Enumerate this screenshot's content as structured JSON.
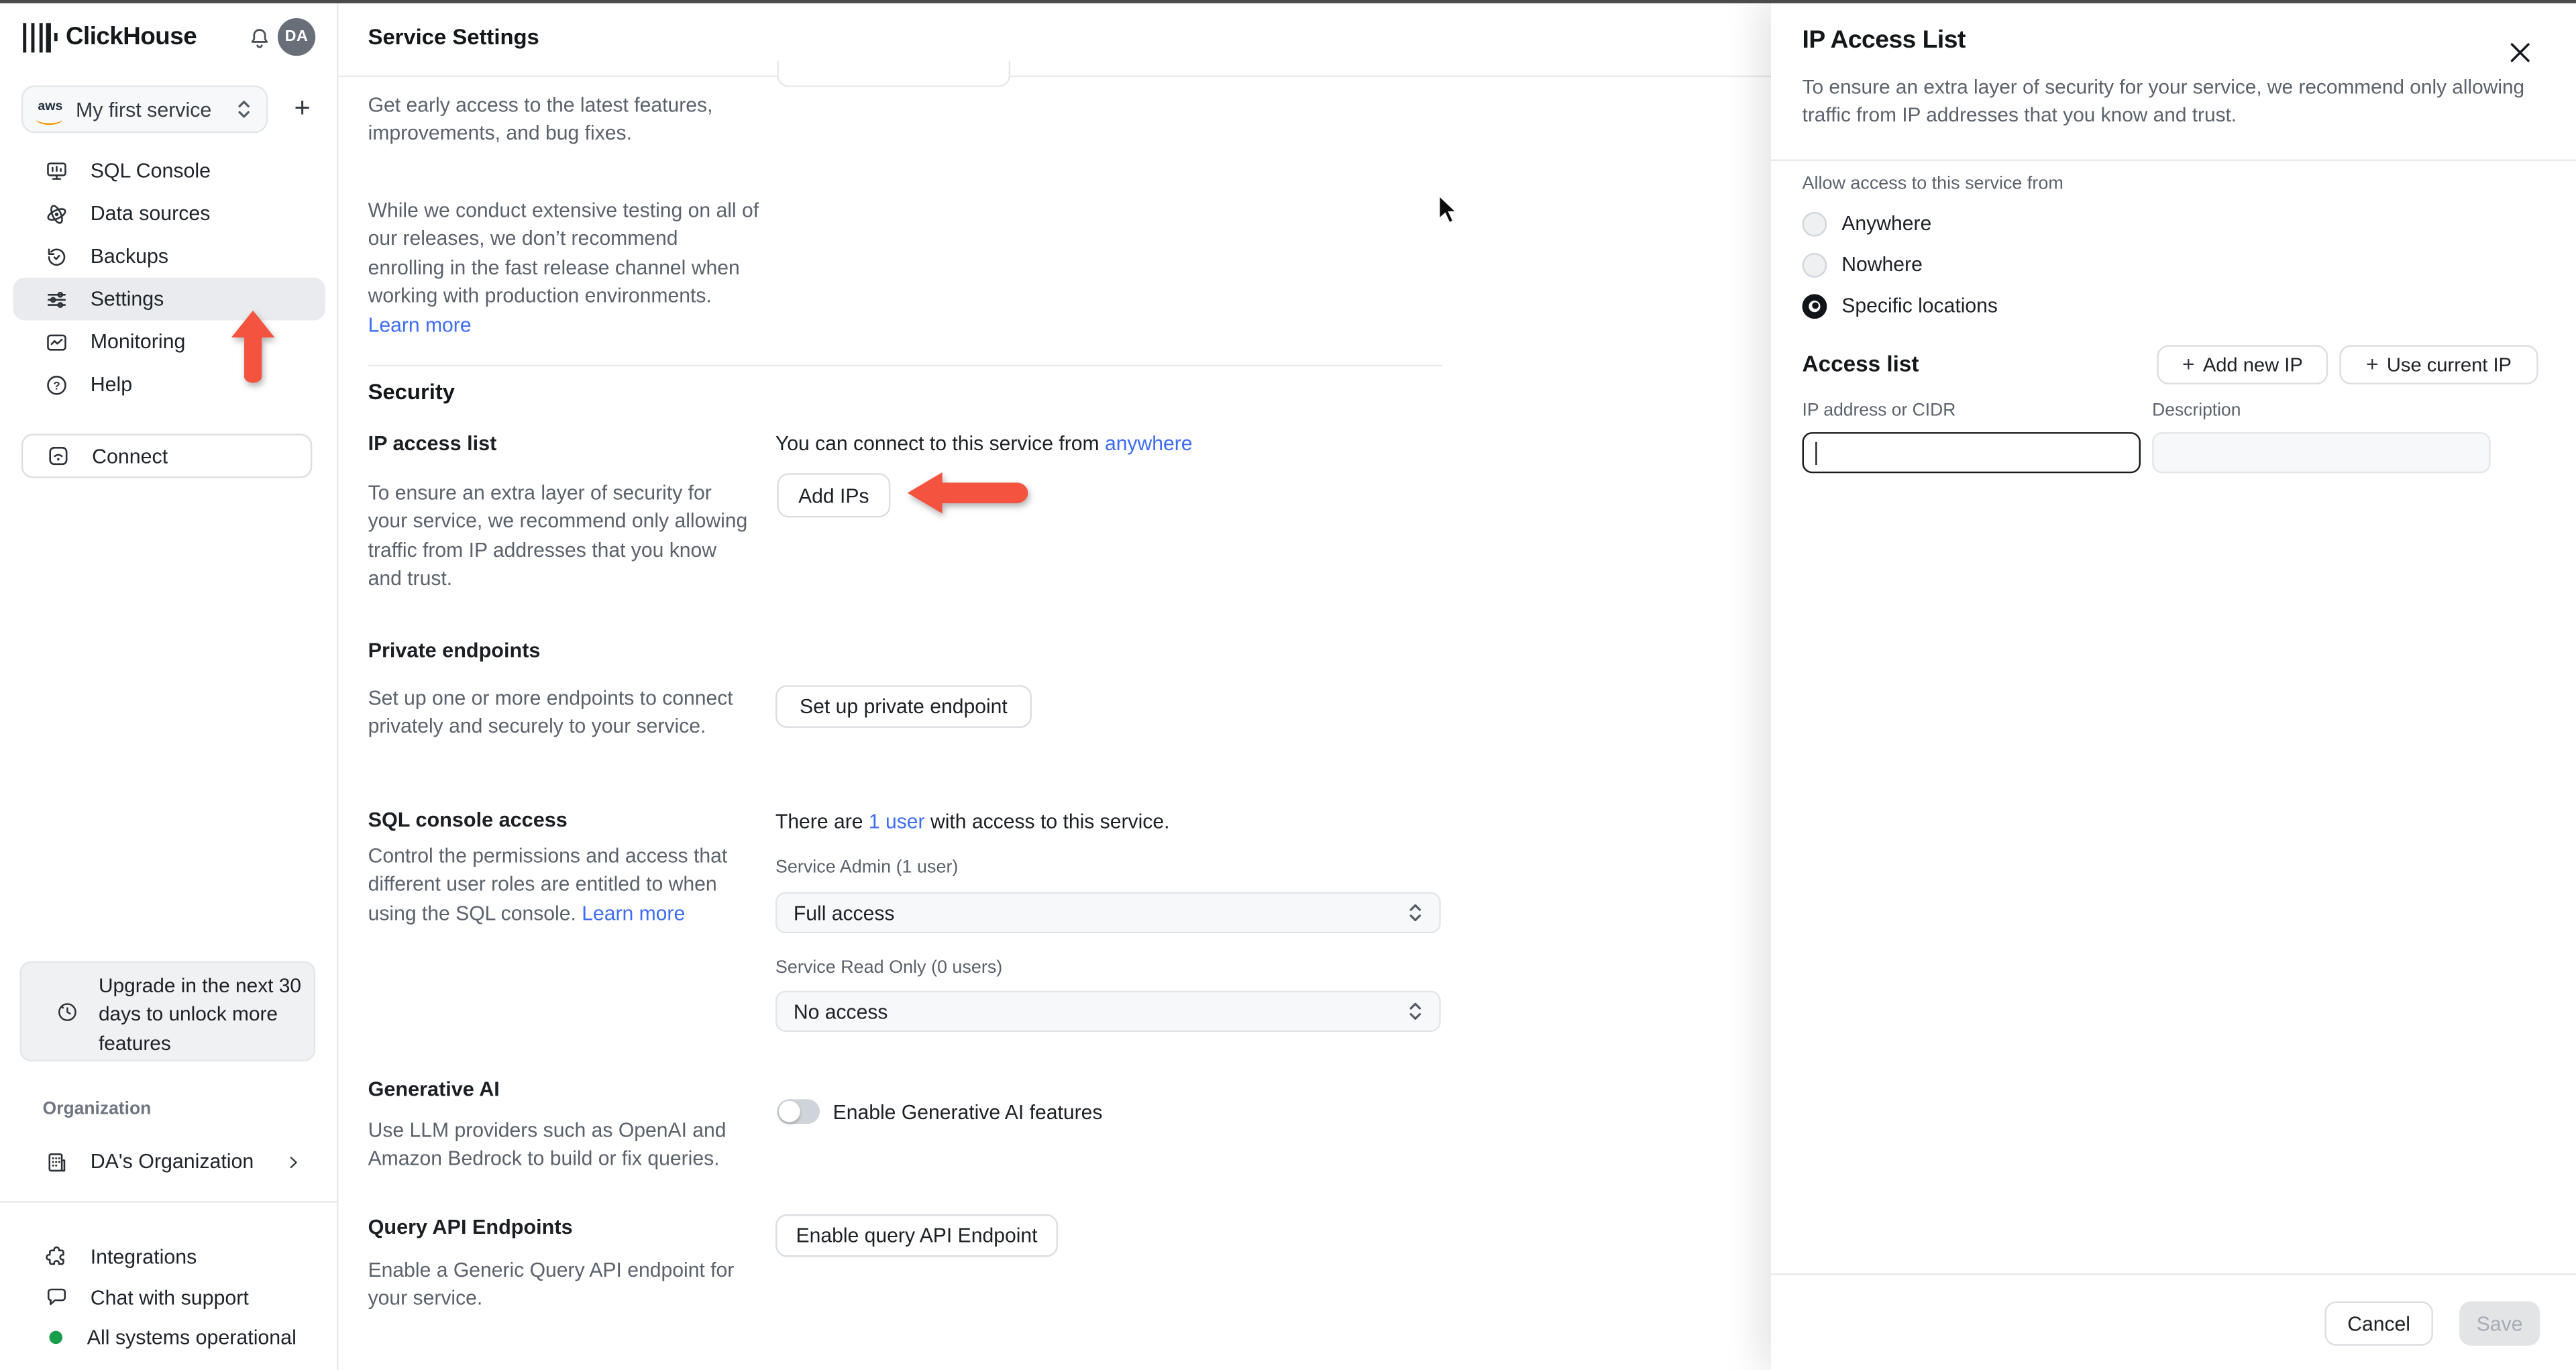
{
  "sidebar": {
    "brand": "ClickHouse",
    "avatar_initials": "DA",
    "service_selector": {
      "provider": "aws",
      "label": "My first service"
    },
    "add_service_label": "+",
    "nav": [
      {
        "label": "SQL Console"
      },
      {
        "label": "Data sources"
      },
      {
        "label": "Backups"
      },
      {
        "label": "Settings"
      },
      {
        "label": "Monitoring"
      },
      {
        "label": "Help"
      }
    ],
    "connect_label": "Connect",
    "upgrade_notice": "Upgrade in the next 30 days to unlock more features",
    "organization_label": "Organization",
    "organization_name": "DA's Organization",
    "integrations_label": "Integrations",
    "chat_label": "Chat with support",
    "status_label": "All systems operational",
    "status_color": "#189e4a"
  },
  "main": {
    "title": "Service Settings",
    "fast_release": {
      "para1": "Get early access to the latest features, improvements, and bug fixes.",
      "para2": "While we conduct extensive testing on all of our releases, we don’t recommend enrolling in the fast release channel when working with production environments. ",
      "learn_more": "Learn more"
    },
    "security": {
      "heading": "Security",
      "ip_access": {
        "label": "IP access list",
        "description": "To ensure an extra layer of security for your service, we recommend only allowing traffic from IP addresses that you know and trust.",
        "connect_prefix": "You can connect to this service from ",
        "connect_link": "anywhere",
        "add_ips_button": "Add IPs"
      },
      "private_endpoints": {
        "label": "Private endpoints",
        "description": "Set up one or more endpoints to connect privately and securely to your service.",
        "button": "Set up private endpoint"
      },
      "sql_console_access": {
        "label": "SQL console access",
        "users_prefix": "There are ",
        "users_link": "1 user",
        "users_suffix": " with access to this service.",
        "description": "Control the permissions and access that different user roles are entitled to when using the SQL console. ",
        "learn_more": "Learn more",
        "admin_label": "Service Admin (1 user)",
        "admin_value": "Full access",
        "readonly_label": "Service Read Only (0 users)",
        "readonly_value": "No access"
      },
      "generative_ai": {
        "label": "Generative AI",
        "description": "Use LLM providers such as OpenAI and Amazon Bedrock to build or fix queries.",
        "toggle_label": "Enable Generative AI features",
        "toggle_state": "off"
      },
      "query_api": {
        "label": "Query API Endpoints",
        "description": "Enable a Generic Query API endpoint for your service.",
        "button": "Enable query API Endpoint"
      }
    }
  },
  "panel": {
    "title": "IP Access List",
    "subtitle": "To ensure an extra layer of security for your service, we recommend only allowing traffic from IP addresses that you know and trust.",
    "allow_label": "Allow access to this service from",
    "options": [
      {
        "label": "Anywhere",
        "selected": false
      },
      {
        "label": "Nowhere",
        "selected": false
      },
      {
        "label": "Specific locations",
        "selected": true
      }
    ],
    "access_list_heading": "Access list",
    "add_new_ip_button": "Add new IP",
    "use_current_ip_button": "Use current IP",
    "ip_field": {
      "label": "IP address or CIDR",
      "value": ""
    },
    "description_field": {
      "label": "Description",
      "value": ""
    },
    "cancel_button": "Cancel",
    "save_button": "Save"
  },
  "colors": {
    "accent_red": "#f4543f",
    "link_blue": "#3e6df5"
  }
}
